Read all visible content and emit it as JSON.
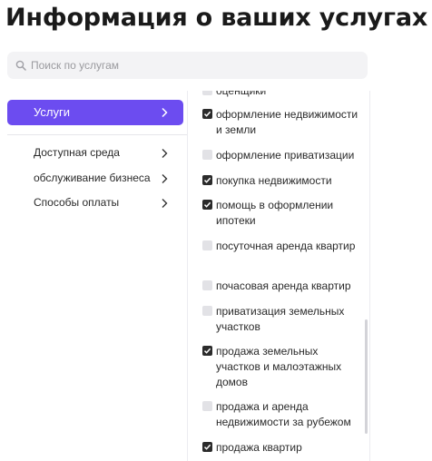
{
  "page": {
    "title": "Информация о ваших услугах"
  },
  "search": {
    "placeholder": "Поиск по услугам",
    "value": ""
  },
  "nav": {
    "active": {
      "label": "Услуги"
    },
    "items": [
      {
        "label": "Доступная среда"
      },
      {
        "label": "обслуживание бизнеса"
      },
      {
        "label": "Способы оплаты"
      }
    ]
  },
  "services": [
    {
      "label": "оценщики",
      "checked": false
    },
    {
      "label": "оформление недвижимости и земли",
      "checked": true
    },
    {
      "label": "оформление приватизации",
      "checked": false
    },
    {
      "label": "покупка недвижимости",
      "checked": true
    },
    {
      "label": "помощь в оформлении ипотеки",
      "checked": true
    },
    {
      "label": "посуточная аренда квартир",
      "checked": false
    },
    {
      "label": "почасовая аренда квартир",
      "checked": false
    },
    {
      "label": "приватизация земельных участков",
      "checked": false
    },
    {
      "label": "продажа земельных участков и малоэтажных домов",
      "checked": true
    },
    {
      "label": "продажа и аренда недвижимости за рубежом",
      "checked": false
    },
    {
      "label": "продажа квартир",
      "checked": true
    }
  ],
  "colors": {
    "accent": "#6c4cf0",
    "checkbox_on": "#2b2b2b",
    "checkbox_off": "#e2e2e6"
  }
}
